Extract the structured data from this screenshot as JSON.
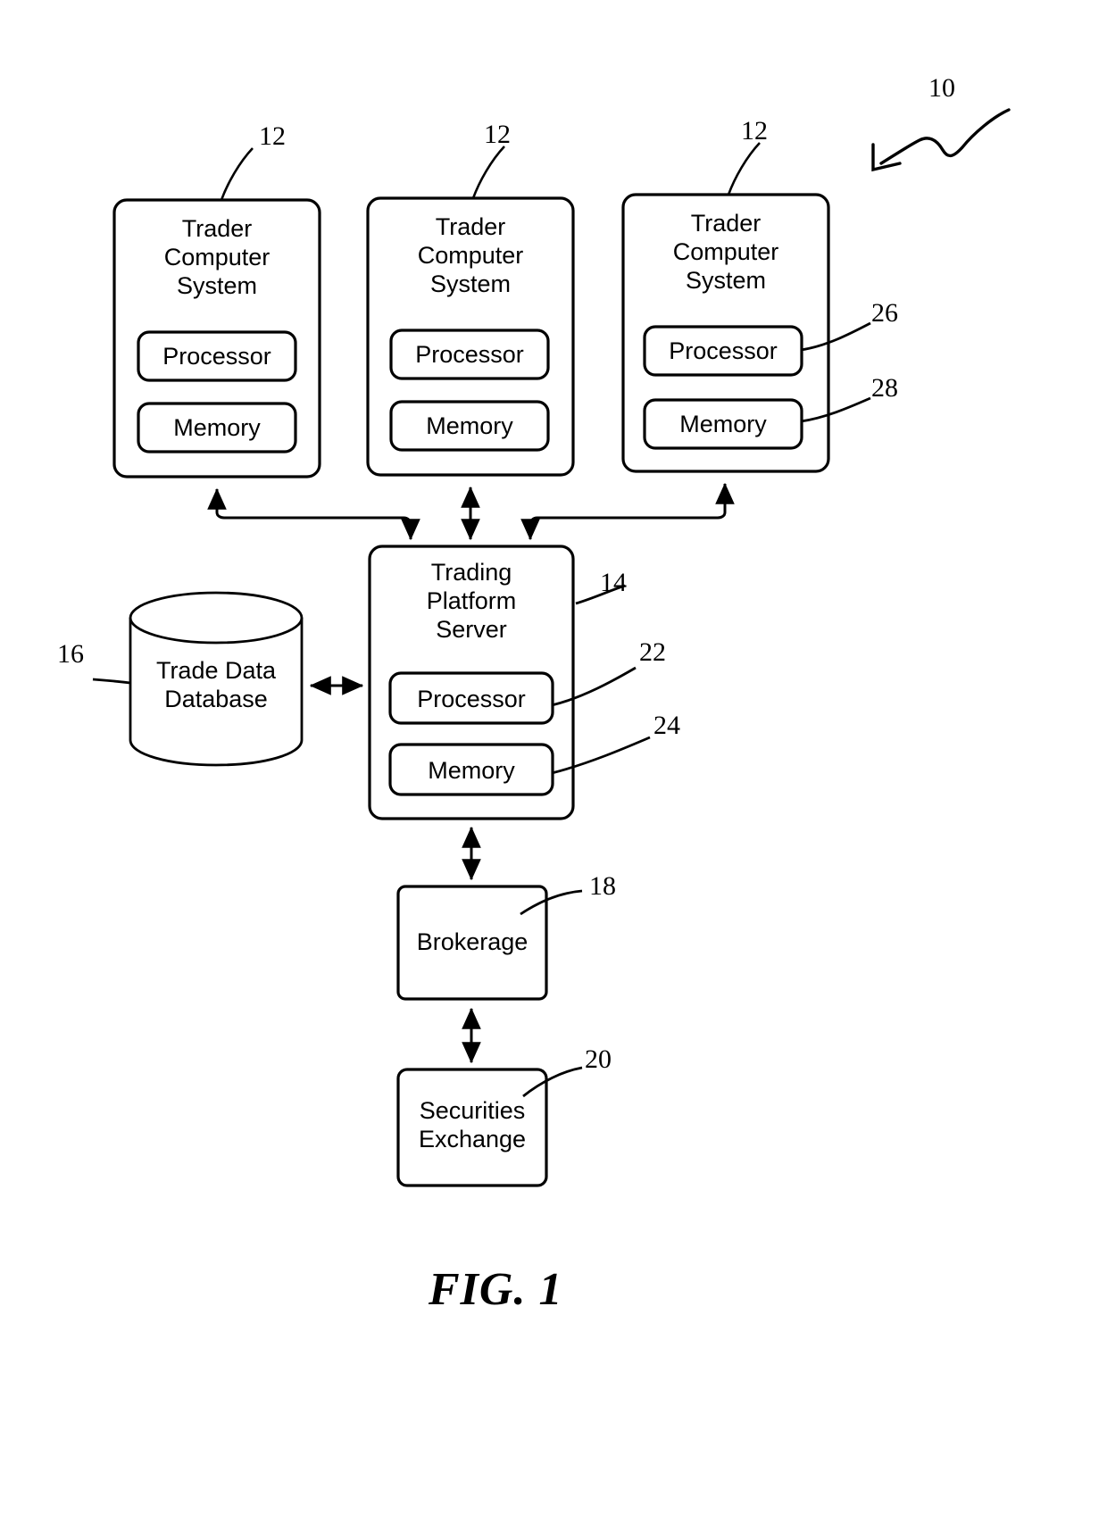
{
  "figure": {
    "caption": "FIG. 1",
    "system_ref": "10"
  },
  "nodes": {
    "trader1": {
      "title": "Trader\nComputer\nSystem",
      "ref": "12",
      "processor": "Processor",
      "memory": "Memory"
    },
    "trader2": {
      "title": "Trader\nComputer\nSystem",
      "ref": "12",
      "processor": "Processor",
      "memory": "Memory"
    },
    "trader3": {
      "title": "Trader\nComputer\nSystem",
      "ref": "12",
      "processor": "Processor",
      "memory": "Memory",
      "processor_ref": "26",
      "memory_ref": "28"
    },
    "server": {
      "title": "Trading\nPlatform\nServer",
      "ref": "14",
      "processor": "Processor",
      "memory": "Memory",
      "processor_ref": "22",
      "memory_ref": "24"
    },
    "database": {
      "title": "Trade Data\nDatabase",
      "ref": "16"
    },
    "brokerage": {
      "title": "Brokerage",
      "ref": "18"
    },
    "exchange": {
      "title": "Securities\nExchange",
      "ref": "20"
    }
  },
  "style": {
    "line_color": "#000000",
    "background": "#ffffff"
  }
}
